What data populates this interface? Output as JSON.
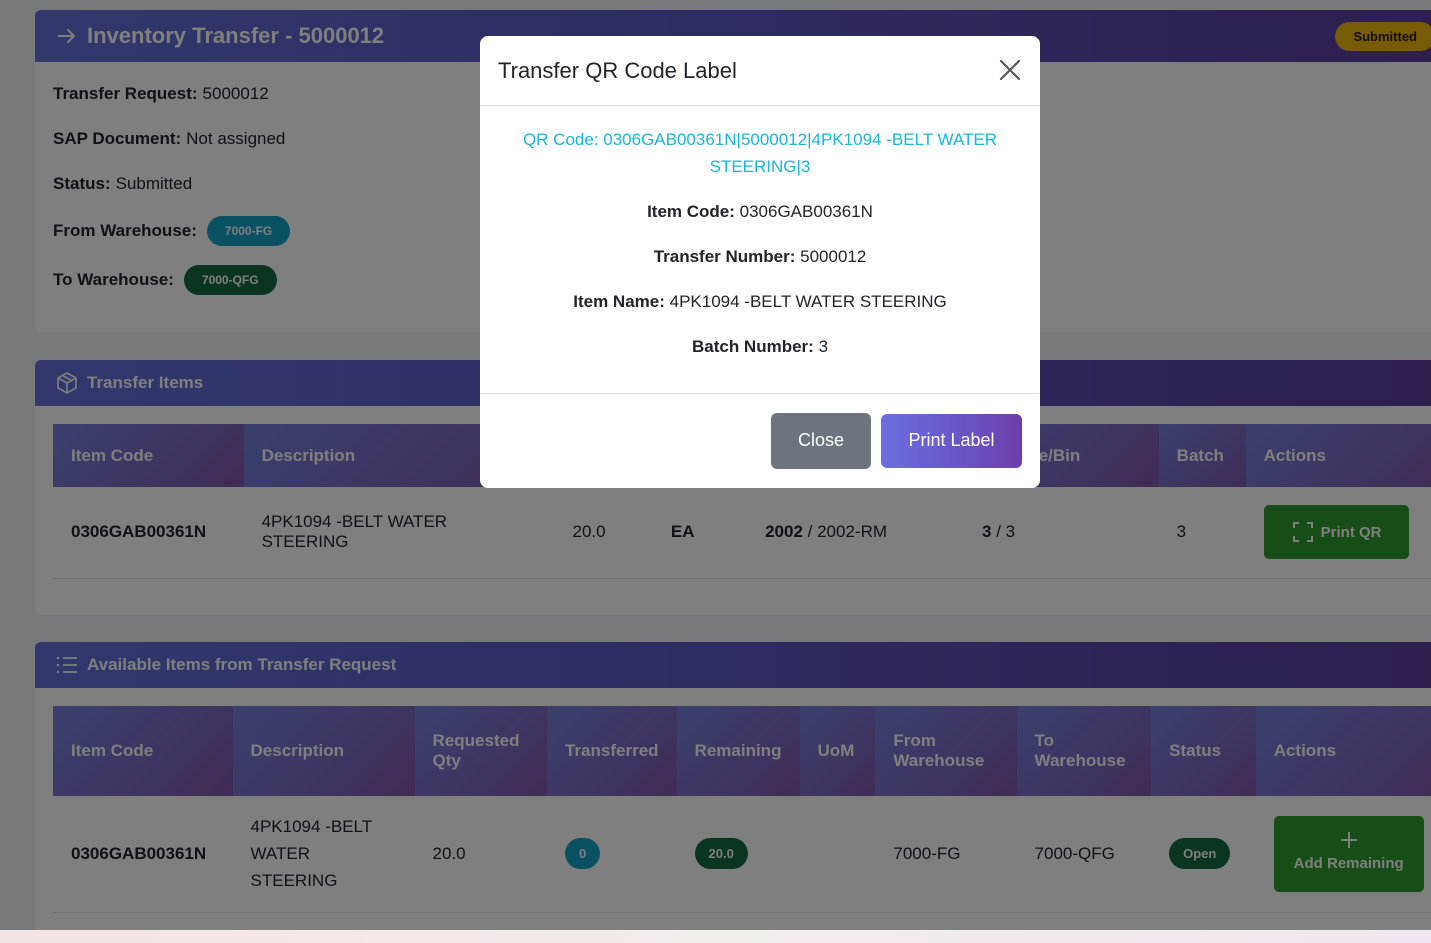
{
  "header": {
    "title": "Inventory Transfer - 5000012",
    "status_badge": "Submitted"
  },
  "details": {
    "transfer_request_label": "Transfer Request:",
    "transfer_request_value": "5000012",
    "sap_document_label": "SAP Document:",
    "sap_document_value": "Not assigned",
    "status_label": "Status:",
    "status_value": "Submitted",
    "from_warehouse_label": "From Warehouse:",
    "from_warehouse_value": "7000-FG",
    "to_warehouse_label": "To Warehouse:",
    "to_warehouse_value": "7000-QFG"
  },
  "transfer_items": {
    "title": "Transfer Items",
    "columns": [
      "Item Code",
      "Description",
      "",
      "",
      "",
      "rehouse/Bin",
      "Batch",
      "Actions"
    ],
    "row": {
      "item_code": "0306GAB00361N",
      "description": "4PK1094 -BELT WATER STEERING",
      "qty": "20.0",
      "uom": "EA",
      "from_bold": "2002",
      "from_rest": "/ 2002-RM",
      "to_bold": "3",
      "to_rest": "/ 3",
      "batch": "3",
      "action": "Print QR"
    }
  },
  "available_items": {
    "title": "Available Items from Transfer Request",
    "columns": [
      "Item Code",
      "Description",
      "Requested Qty",
      "Transferred",
      "Remaining",
      "UoM",
      "From Warehouse",
      "To Warehouse",
      "Status",
      "Actions"
    ],
    "row": {
      "item_code": "0306GAB00361N",
      "description": "4PK1094 -BELT WATER STEERING",
      "requested_qty": "20.0",
      "transferred": "0",
      "remaining": "20.0",
      "uom": "",
      "from_warehouse": "7000-FG",
      "to_warehouse": "7000-QFG",
      "status": "Open",
      "action": "Add Remaining"
    }
  },
  "modal": {
    "title": "Transfer QR Code Label",
    "qr_code": "QR Code: 0306GAB00361N|5000012|4PK1094 -BELT WATER STEERING|3",
    "item_code_label": "Item Code:",
    "item_code_value": "0306GAB00361N",
    "transfer_number_label": "Transfer Number:",
    "transfer_number_value": "5000012",
    "item_name_label": "Item Name:",
    "item_name_value": "4PK1094 -BELT WATER STEERING",
    "batch_number_label": "Batch Number:",
    "batch_number_value": "3",
    "close_button": "Close",
    "print_button": "Print Label"
  },
  "colors": {
    "header_gradient_start": "#6471d9",
    "header_gradient_end": "#5c3d9e",
    "status_submitted": "#f1b70c",
    "badge_cyan": "#17a2c8",
    "badge_green": "#146c43",
    "qr_text": "#17b7d8",
    "print_qr_button": "#2e9a2e"
  }
}
